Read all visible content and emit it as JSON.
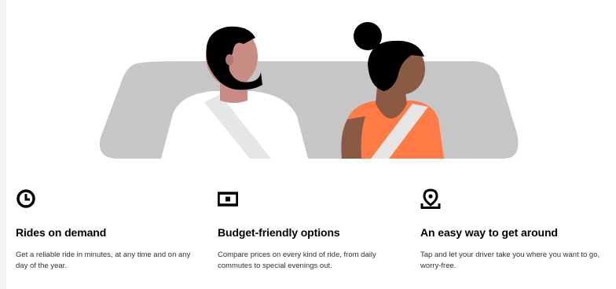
{
  "colors": {
    "window": "#c6c6c6",
    "skin_man": "#c98c85",
    "hair": "#000000",
    "shirt_man": "#ffffff",
    "skin_woman": "#8a5a44",
    "dress_woman": "#ff7a45",
    "belt": "#e8e8e8",
    "text_primary": "#000000",
    "text_secondary": "#333333"
  },
  "features": [
    {
      "icon": "clock-icon",
      "title": "Rides on demand",
      "description": "Get a reliable ride in minutes, at any time and on any day of the year."
    },
    {
      "icon": "cash-icon",
      "title": "Budget-friendly options",
      "description": "Compare prices on every kind of ride, from daily commutes to special evenings out."
    },
    {
      "icon": "map-pin-icon",
      "title": "An easy way to get around",
      "description": "Tap and let your driver take you where you want to go, worry-free."
    }
  ]
}
